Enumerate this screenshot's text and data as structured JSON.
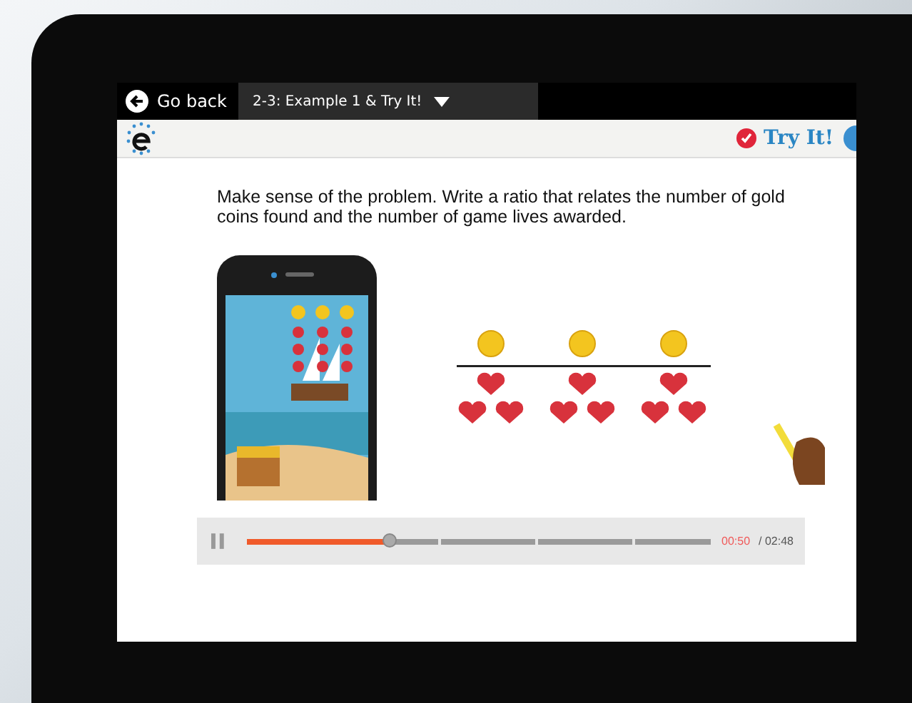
{
  "top_bar": {
    "back_button": "Go back",
    "lesson_menu": "2-3: Example 1 & Try It!"
  },
  "toolbar": {
    "try_it_button": "Try It!"
  },
  "lesson": {
    "prompt": "Make sense of the problem. Write a ratio that relates the number of gold coins found and the number of game lives awarded."
  },
  "player": {
    "playing": true,
    "level": 0.31,
    "elapsed": "00:50",
    "total": "/ 02:48"
  }
}
